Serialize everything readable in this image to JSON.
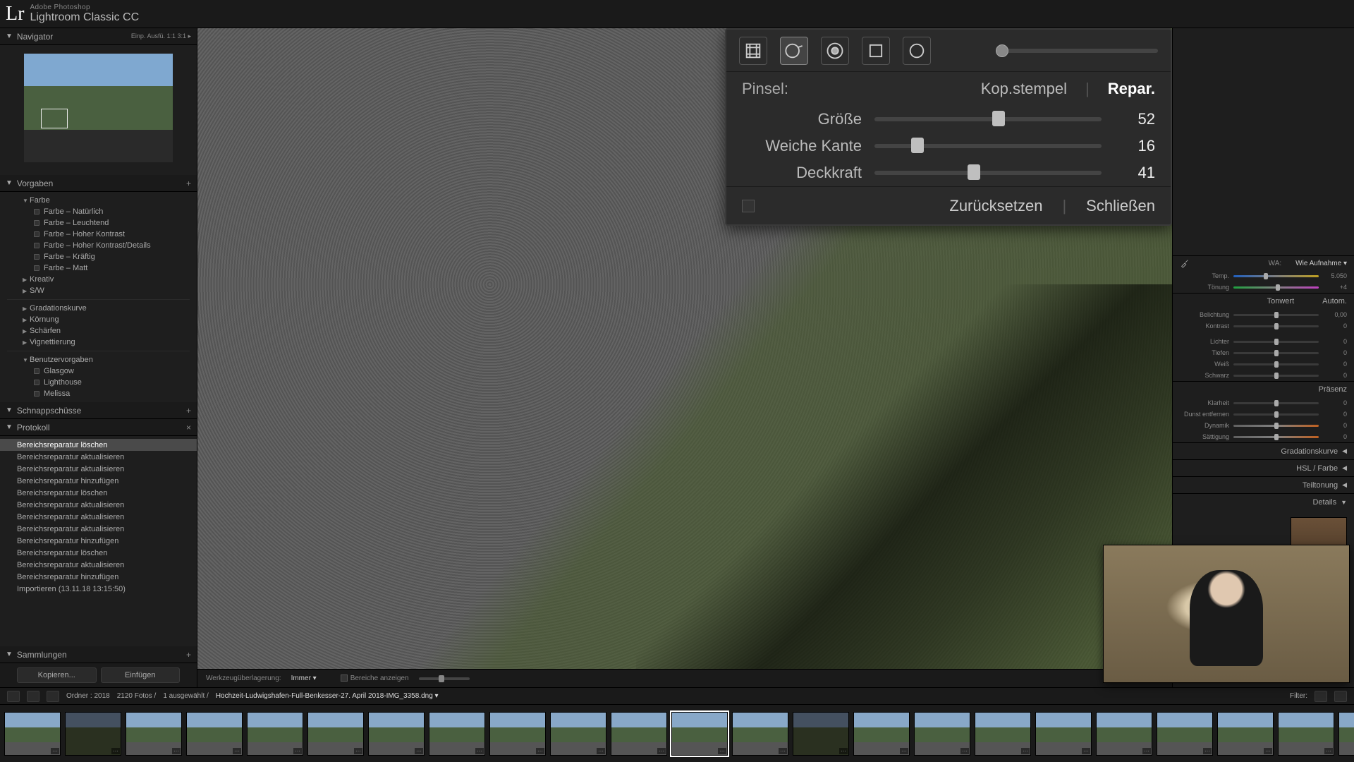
{
  "app": {
    "logo": "Lr",
    "subtitle": "Adobe Photoshop",
    "title": "Lightroom Classic CC"
  },
  "navigator": {
    "title": "Navigator",
    "zoom_opts": "Einp.   Ausfü.   1:1      3:1  ▸"
  },
  "presets": {
    "title": "Vorgaben",
    "groups": [
      {
        "label": "Farbe",
        "items": [
          "Farbe – Natürlich",
          "Farbe – Leuchtend",
          "Farbe – Hoher Kontrast",
          "Farbe – Hoher Kontrast/Details",
          "Farbe – Kräftig",
          "Farbe – Matt"
        ]
      },
      {
        "label": "Kreativ",
        "items": []
      },
      {
        "label": "S/W",
        "items": []
      }
    ],
    "singles": [
      "Gradationskurve",
      "Körnung",
      "Schärfen",
      "Vignettierung"
    ],
    "user_title": "Benutzervorgaben",
    "user_items": [
      "Glasgow",
      "Lighthouse",
      "Melissa"
    ]
  },
  "snapshots": {
    "title": "Schnappschüsse"
  },
  "history": {
    "title": "Protokoll",
    "items": [
      "Bereichsreparatur löschen",
      "Bereichsreparatur aktualisieren",
      "Bereichsreparatur aktualisieren",
      "Bereichsreparatur hinzufügen",
      "Bereichsreparatur löschen",
      "Bereichsreparatur aktualisieren",
      "Bereichsreparatur aktualisieren",
      "Bereichsreparatur aktualisieren",
      "Bereichsreparatur hinzufügen",
      "Bereichsreparatur löschen",
      "Bereichsreparatur aktualisieren",
      "Bereichsreparatur hinzufügen",
      "Importieren (13.11.18 13:15:50)"
    ],
    "selected": 0
  },
  "collections": {
    "title": "Sammlungen"
  },
  "left_buttons": {
    "copy": "Kopieren...",
    "paste": "Einfügen"
  },
  "center_toolbar": {
    "overlay_label": "Werkzeugüberlagerung:",
    "overlay_value": "Immer ▾",
    "show_areas": "Bereiche anzeigen"
  },
  "spot_panel": {
    "brush_label": "Pinsel:",
    "mode_clone": "Kop.stempel",
    "mode_heal": "Repar.",
    "sliders": {
      "size": {
        "label": "Größe",
        "value": "52",
        "pct": 52
      },
      "feather": {
        "label": "Weiche Kante",
        "value": "16",
        "pct": 16
      },
      "opacity": {
        "label": "Deckkraft",
        "value": "41",
        "pct": 41
      }
    },
    "reset": "Zurücksetzen",
    "close": "Schließen"
  },
  "right": {
    "wb_label": "WA:",
    "wb_value": "Wie Aufnahme ▾",
    "temp": {
      "label": "Temp.",
      "value": "5.050"
    },
    "tint": {
      "label": "Tönung",
      "value": "+4"
    },
    "tone_hdr": "Tonwert",
    "tone_auto": "Autom.",
    "exposure": {
      "label": "Belichtung",
      "value": "0,00"
    },
    "contrast": {
      "label": "Kontrast",
      "value": "0"
    },
    "highlights": {
      "label": "Lichter",
      "value": "0"
    },
    "shadows": {
      "label": "Tiefen",
      "value": "0"
    },
    "whites": {
      "label": "Weiß",
      "value": "0"
    },
    "blacks": {
      "label": "Schwarz",
      "value": "0"
    },
    "presence_hdr": "Präsenz",
    "clarity": {
      "label": "Klarheit",
      "value": "0"
    },
    "dehaze": {
      "label": "Dunst entfernen",
      "value": "0"
    },
    "vibrance": {
      "label": "Dynamik",
      "value": "0"
    },
    "saturation": {
      "label": "Sättigung",
      "value": "0"
    },
    "panels": {
      "curve": "Gradationskurve",
      "hsl": "HSL / Farbe",
      "split": "Teiltonung",
      "detail": "Details"
    }
  },
  "pathbar": {
    "folder": "Ordner : 2018",
    "count": "2120 Fotos /",
    "sel": "1 ausgewählt /",
    "filename": "Hochzeit-Ludwigshafen-Full-Benkesser-27. April 2018-IMG_3358.dng ▾",
    "filter_label": "Filter:"
  },
  "filmstrip": {
    "count": 23,
    "selected": 11
  }
}
